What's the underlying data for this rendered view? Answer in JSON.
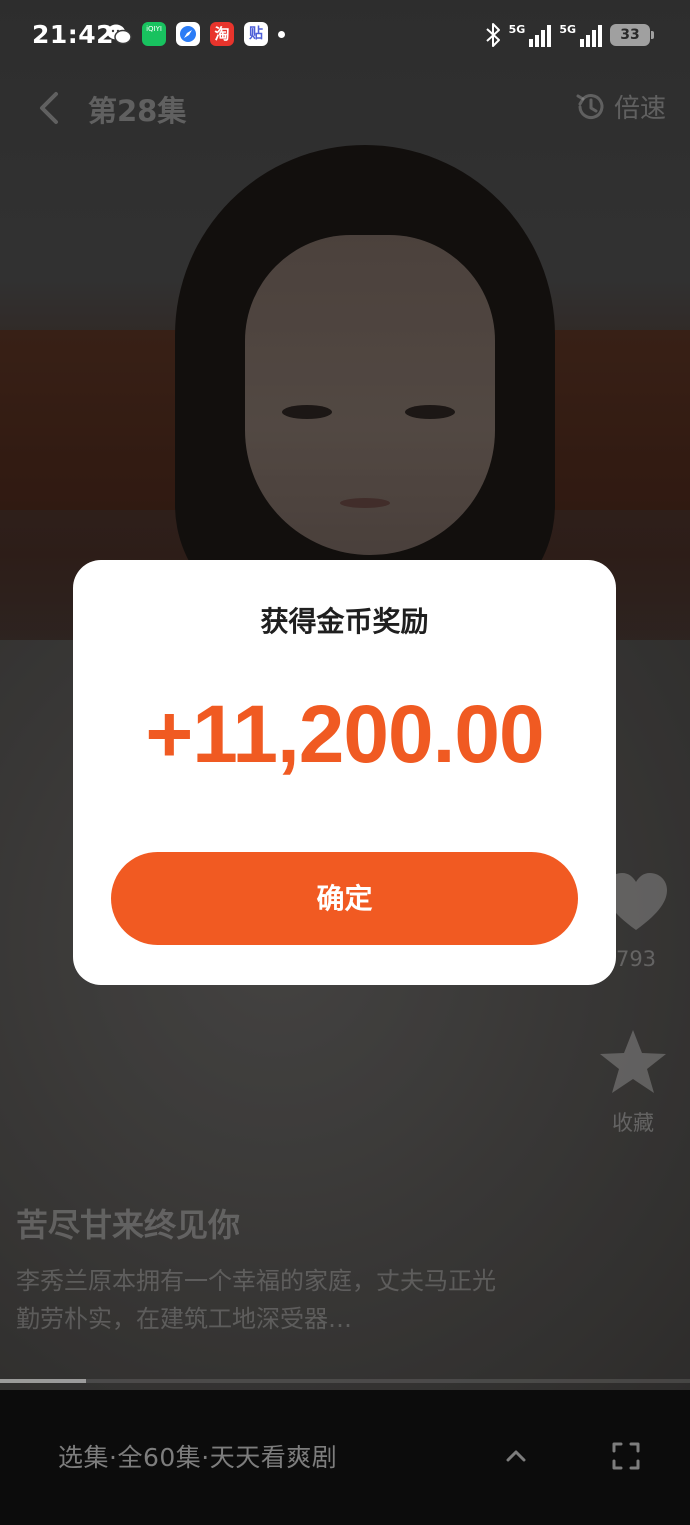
{
  "status_bar": {
    "time": "21:42",
    "apps": [
      {
        "name": "wechat-icon",
        "label": "",
        "color": "#ffffff"
      },
      {
        "name": "iqiyi-icon",
        "label": "iQIYI",
        "color": "#18c25f"
      },
      {
        "name": "compass-app-icon",
        "label": "",
        "color": "#2b7cf6"
      },
      {
        "name": "taobao-icon",
        "label": "淘",
        "color": "#e8342c"
      },
      {
        "name": "tieba-icon",
        "label": "贴",
        "color": "#4e5fd8"
      }
    ],
    "network_1": "5G",
    "network_2": "5G",
    "battery": "33"
  },
  "nav": {
    "episode": "第28集",
    "speed_label": "倍速"
  },
  "side_actions": {
    "like_count": "793",
    "favorite_label": "收藏"
  },
  "drama": {
    "title": "苦尽甘来终见你",
    "description": "李秀兰原本拥有一个幸福的家庭，丈夫马正光勤劳朴实，在建筑工地深受器…"
  },
  "playback": {
    "progress": 0.125
  },
  "bottom_bar": {
    "episode_selector": "选集·全60集·天天看爽剧"
  },
  "reward_dialog": {
    "title": "获得金币奖励",
    "amount": "+11,200.00",
    "confirm_label": "确定"
  },
  "colors": {
    "accent": "#f15a22",
    "amount": "#f05a22",
    "dialog_bg": "#ffffff"
  }
}
